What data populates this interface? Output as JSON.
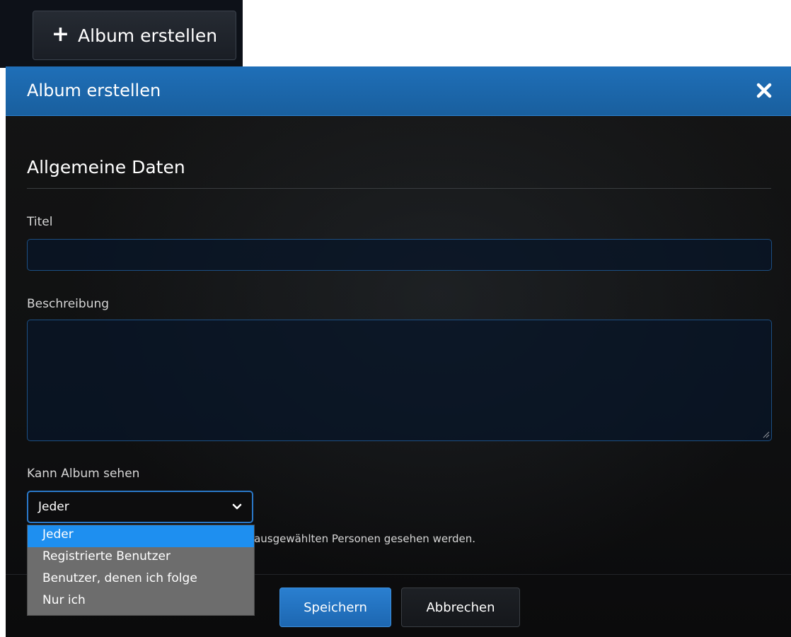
{
  "create_button": {
    "icon": "plus-icon",
    "label": "Album erstellen"
  },
  "modal": {
    "title": "Album erstellen",
    "close_icon": "close-icon",
    "header_color": "#1f6fb8"
  },
  "form": {
    "section_title": "Allgemeine Daten",
    "title_label": "Titel",
    "title_value": "",
    "description_label": "Beschreibung",
    "description_value": "",
    "visibility_label": "Kann Album sehen",
    "visibility_selected": "Jeder",
    "visibility_options": [
      "Jeder",
      "Registrierte Benutzer",
      "Benutzer, denen ich folge",
      "Nur ich"
    ],
    "hint": "Die Bilder und Videos können nur von den ausgewählten Personen gesehen werden."
  },
  "footer": {
    "save_label": "Speichern",
    "cancel_label": "Abbrechen"
  },
  "colors": {
    "accent": "#1e8ff0",
    "dropdown_bg": "#6d6d6d"
  }
}
